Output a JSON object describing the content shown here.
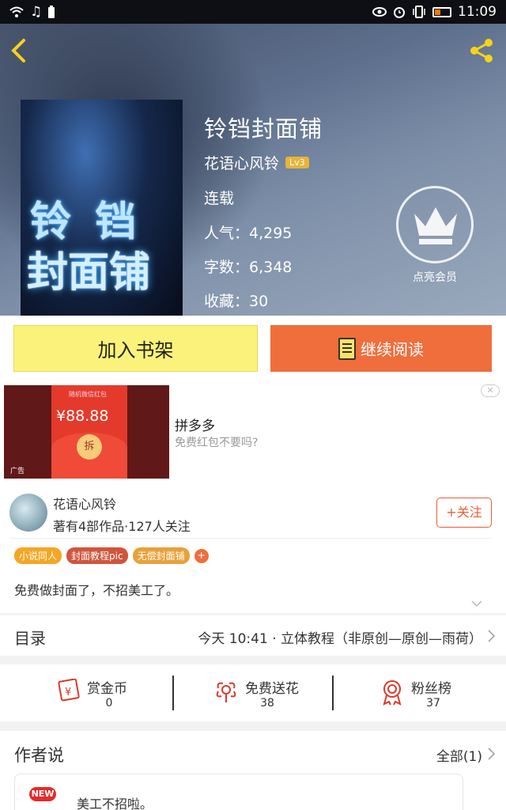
{
  "status_bar": {
    "time": "11:09",
    "icons_left": [
      "wifi-icon",
      "music-icon",
      "battery-saver-icon"
    ],
    "icons_right": [
      "eye-icon",
      "alarm-icon",
      "vibrate-icon",
      "battery-icon"
    ]
  },
  "book": {
    "title": "铃铛封面铺",
    "author": "花语心风铃",
    "level": "Lv3",
    "status": "连载",
    "popularity": "人气：4,295",
    "word_count": "字数：6,348",
    "favorites": "收藏：30",
    "cover_text_line1": "铃 铛",
    "cover_text_line2": "封面铺",
    "vip_label": "点亮会员"
  },
  "actions": {
    "shelf_label": "加入书架",
    "read_label": "继续阅读"
  },
  "ad": {
    "title": "拼多多",
    "subtitle": "免费红包不要吗?",
    "amount": "¥88.88",
    "banner_sub": "随机微信红包",
    "coin_text": "拆",
    "ad_tag": "广告"
  },
  "author_card": {
    "name": "花语心风铃",
    "info": "著有4部作品·127人关注",
    "follow_label": "+关注",
    "tags": [
      {
        "label": "小说同人",
        "color": "#f5a623"
      },
      {
        "label": "封面教程pic",
        "color": "#d0553c"
      },
      {
        "label": "无偿封面铺",
        "color": "#e8a13a"
      }
    ],
    "tag_more": "+",
    "bio": "免费做封面了，不招美工了。"
  },
  "toc": {
    "label": "目录",
    "latest": "今天 10:41 · 立体教程（非原创—原创—雨荷）"
  },
  "stats": [
    {
      "label": "赏金币",
      "value": "0"
    },
    {
      "label": "免费送花",
      "value": "38"
    },
    {
      "label": "粉丝榜",
      "value": "37"
    }
  ],
  "author_says": {
    "label": "作者说",
    "all_label": "全部(1)",
    "badge": "NEW",
    "note": "美工不招啦。"
  },
  "colors": {
    "accent": "#ef6e3c",
    "shelf": "#fbf27b",
    "gold": "#e8b33a",
    "red": "#e32b2b"
  }
}
